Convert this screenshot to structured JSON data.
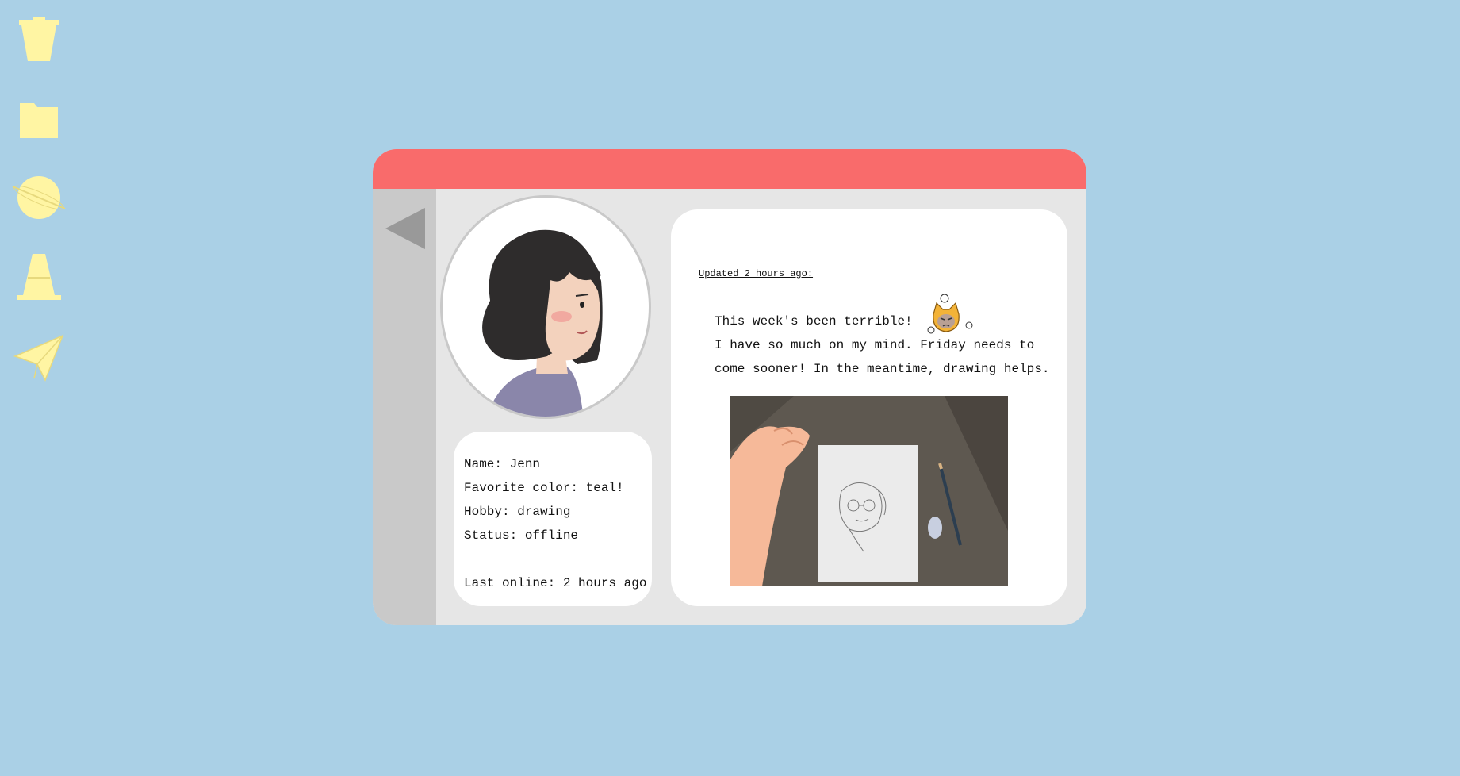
{
  "desktop": {
    "icons": [
      {
        "name": "trash",
        "icon": "trash-icon"
      },
      {
        "name": "folder",
        "icon": "folder-icon"
      },
      {
        "name": "planet",
        "icon": "planet-icon"
      },
      {
        "name": "traffic-cone",
        "icon": "cone-icon"
      },
      {
        "name": "paper-plane",
        "icon": "paper-plane-icon"
      }
    ],
    "icon_color": "#fff5a3"
  },
  "colors": {
    "background": "#aad0e6",
    "titlebar": "#f96b6b",
    "window": "#e6e6e6",
    "rail": "#c9c9c9",
    "card": "#ffffff"
  },
  "profile": {
    "name_line": "Name: Jenn",
    "color_line": "Favorite color: teal!",
    "hobby_line": "Hobby: drawing",
    "status_line": "Status: offline",
    "last_online_line": "Last online: 2 hours ago"
  },
  "post": {
    "updated": "Updated 2 hours ago:",
    "lines": [
      "This week's been terrible!",
      "I have so much on my mind. Friday needs to",
      "come sooner! In the meantime, drawing helps."
    ]
  }
}
